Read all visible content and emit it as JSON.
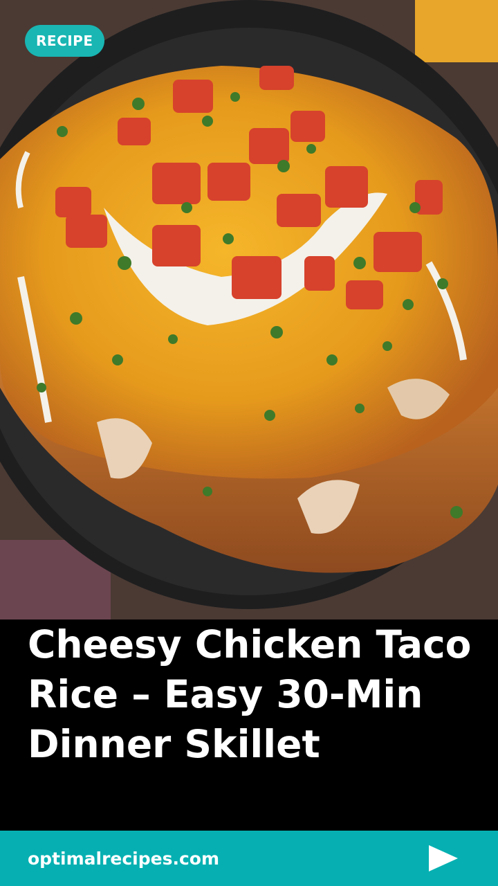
{
  "badge": {
    "label": "RECIPE"
  },
  "title": "Cheesy Chicken Taco Rice – Easy 30-Min Dinner Skillet",
  "footer": {
    "site": "optimalrecipes.com",
    "play_icon": "play-triangle-icon"
  },
  "colors": {
    "accent": "#19b6b3",
    "footer_bg": "#06b0b2",
    "title_bg": "#000000",
    "text": "#ffffff"
  },
  "hero": {
    "image": "food-photo"
  }
}
